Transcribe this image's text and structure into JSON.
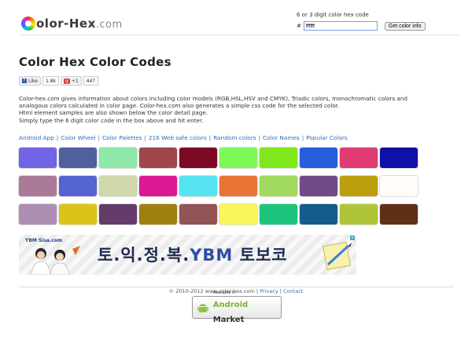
{
  "header": {
    "logo_main": "olor-Hex",
    "logo_domain": ".com",
    "search_label": "6 or 3 digit color hex code",
    "hash": "#",
    "search_value": "ffffff",
    "button_label": "Get color info"
  },
  "page_title": "Color Hex Color Codes",
  "social": {
    "like_label": "Like",
    "like_count": "1.8k",
    "gplus_label": "+1",
    "gplus_count": "447"
  },
  "description": [
    "Color-hex.com gives information about colors including color models (RGB,HSL,HSV and CMYK), Triadic colors, monochromatic colors and analogous colors calculated in color page. Color-hex.com also generates a simple css code for the selected color.",
    "Html element samples are also shown below the color detail page.",
    "Simply type the 6 digit color code in the box above and hit enter."
  ],
  "nav_links": [
    "Android App",
    "Color Wheel",
    "Color Palettes",
    "216 Web safe colors",
    "Random colors",
    "Color Names",
    "Popular Colors"
  ],
  "swatch_colors": [
    "#7264e6",
    "#50609e",
    "#8ee8a8",
    "#a0464b",
    "#7c0a24",
    "#7dfa56",
    "#7ee81a",
    "#275fda",
    "#e03b73",
    "#1010a6",
    "#aa7a98",
    "#5564d0",
    "#cfd8ab",
    "#dd1894",
    "#55e4ef",
    "#e87535",
    "#a2da5e",
    "#714a88",
    "#bd9e0c",
    "#fffcfa",
    "#ad8eb3",
    "#dac418",
    "#643c6a",
    "#9e8011",
    "#935456",
    "#f9f65a",
    "#1dc57c",
    "#135d8b",
    "#afc537",
    "#5e3115"
  ],
  "ad": {
    "brand": "YBM Sisa.com",
    "headline_korean": "토.익.정.복.",
    "headline_brand": "YBM",
    "headline_tail": "토보코",
    "close": "x"
  },
  "footer": {
    "copyright": "© 2010-2012 www.color-hex.com",
    "privacy": "Privacy",
    "contact": "Contact",
    "market_small": "Available in",
    "market_android": "Android",
    "market_word": "Market"
  }
}
